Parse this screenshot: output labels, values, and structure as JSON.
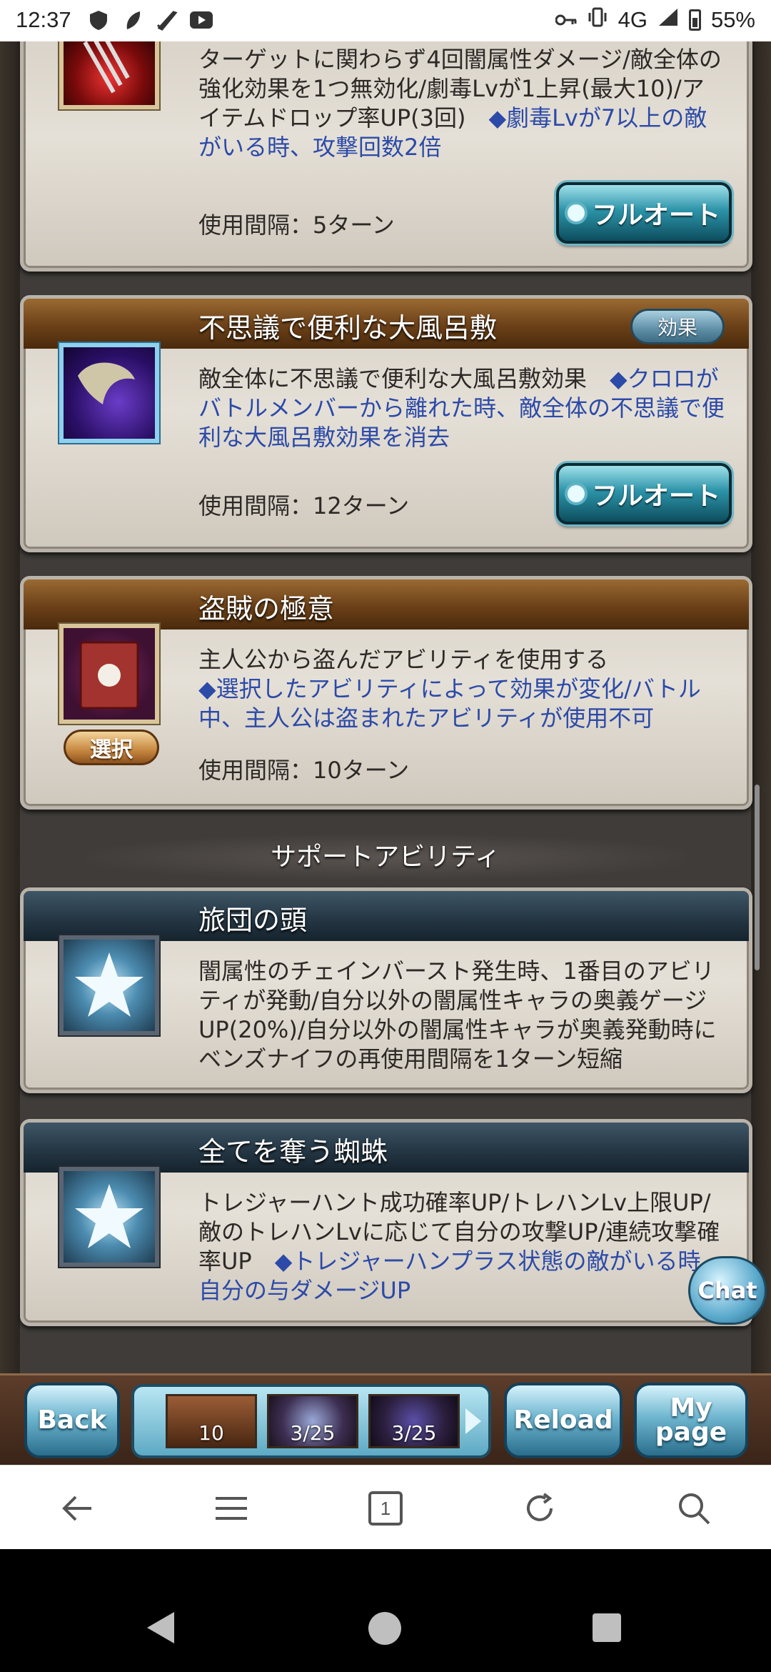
{
  "status_bar": {
    "time": "12:37",
    "network": "4G",
    "battery": "55%"
  },
  "skills": [
    {
      "desc_normal": "ターゲットに関わらず4回闇属性ダメージ/敵全体の強化効果を1つ無効化/劇毒Lvが1上昇(最大10)/アイテムドロップ率UP(3回)　",
      "desc_blue": "◆劇毒Lvが7以上の敵がいる時、攻撃回数2倍",
      "interval": "使用間隔：5ターン",
      "button": "フルオート"
    },
    {
      "title": "不思議で便利な大風呂敷",
      "effect_button": "効果",
      "desc_normal": "敵全体に不思議で便利な大風呂敷効果　",
      "desc_blue": "◆クロロがバトルメンバーから離れた時、敵全体の不思議で便利な大風呂敷効果を消去",
      "interval": "使用間隔：12ターン",
      "button": "フルオート"
    },
    {
      "title": "盗賊の極意",
      "select_button": "選択",
      "desc_normal": "主人公から盗んだアビリティを使用する",
      "desc_blue": "◆選択したアビリティによって効果が変化/バトル中、主人公は盗まれたアビリティが使用不可",
      "interval": "使用間隔：10ターン"
    }
  ],
  "support_heading": "サポートアビリティ",
  "supports": [
    {
      "title": "旅団の頭",
      "desc_normal": "闇属性のチェインバースト発生時、1番目のアビリティが発動/自分以外の闇属性キャラの奥義ゲージUP(20%)/自分以外の闇属性キャラが奥義発動時にベンズナイフの再使用間隔を1ターン短縮"
    },
    {
      "title": "全てを奪う蜘蛛",
      "desc_normal": "トレジャーハント成功確率UP/トレハンLv上限UP/敵のトレハンLvに応じて自分の攻撃UP/連続攻撃確率UP　",
      "desc_blue": "◆トレジャーハンプラス状態の敵がいる時、自分の与ダメージUP"
    }
  ],
  "chat_button": "Chat",
  "game_bar": {
    "back": "Back",
    "reload": "Reload",
    "mypage_line1": "My",
    "mypage_line2": "page",
    "quick_slots": [
      "10",
      "3/25",
      "3/25"
    ]
  },
  "browser_tab_count": "1"
}
